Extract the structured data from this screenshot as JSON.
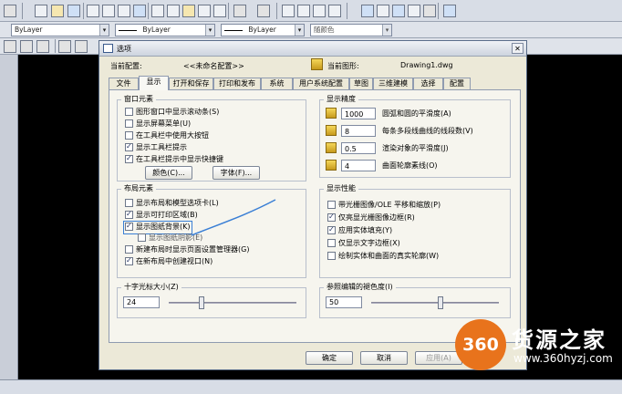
{
  "toolbar": {
    "layer_color": "ByLayer",
    "linetype": "ByLayer",
    "lineweight": "ByLayer",
    "plot_style": "随颜色"
  },
  "dialog": {
    "title": "选项",
    "current_profile_label": "当前配置:",
    "current_profile_value": "<<未命名配置>>",
    "current_drawing_label": "当前图形:",
    "current_drawing_value": "Drawing1.dwg",
    "tabs": [
      "文件",
      "显示",
      "打开和保存",
      "打印和发布",
      "系统",
      "用户系统配置",
      "草图",
      "三维建模",
      "选择",
      "配置"
    ],
    "active_tab": "显示",
    "window_elements": {
      "title": "窗口元素",
      "options": [
        {
          "label": "图形窗口中显示滚动条(S)",
          "checked": false
        },
        {
          "label": "显示屏幕菜单(U)",
          "checked": false
        },
        {
          "label": "在工具栏中使用大按钮",
          "checked": false
        },
        {
          "label": "显示工具栏提示",
          "checked": true
        },
        {
          "label": "在工具栏提示中显示快捷键",
          "checked": true
        }
      ],
      "colors_button": "颜色(C)...",
      "fonts_button": "字体(F)..."
    },
    "layout_elements": {
      "title": "布局元素",
      "options": [
        {
          "label": "显示布局和模型选项卡(L)",
          "checked": false
        },
        {
          "label": "显示可打印区域(B)",
          "checked": true
        },
        {
          "label": "显示图纸背景(K)",
          "checked": true
        },
        {
          "label": "显示图纸阴影(E)",
          "checked": false
        },
        {
          "label": "新建布局时显示页面设置管理器(G)",
          "checked": false
        },
        {
          "label": "在新布局中创建视口(N)",
          "checked": true
        }
      ]
    },
    "display_resolution": {
      "title": "显示精度",
      "items": [
        {
          "value": "1000",
          "label": "圆弧和圆的平滑度(A)"
        },
        {
          "value": "8",
          "label": "每条多段线曲线的线段数(V)"
        },
        {
          "value": "0.5",
          "label": "渲染对象的平滑度(J)"
        },
        {
          "value": "4",
          "label": "曲面轮廓素线(O)"
        }
      ]
    },
    "display_performance": {
      "title": "显示性能",
      "options": [
        {
          "label": "带光栅图像/OLE 平移和缩放(P)",
          "checked": false
        },
        {
          "label": "仅亮显光栅图像边框(R)",
          "checked": true
        },
        {
          "label": "应用实体填充(Y)",
          "checked": true
        },
        {
          "label": "仅显示文字边框(X)",
          "checked": false
        },
        {
          "label": "绘制实体和曲面的真实轮廓(W)",
          "checked": false
        }
      ]
    },
    "crosshair": {
      "title": "十字光标大小(Z)",
      "value": "24"
    },
    "reference_fade": {
      "title": "参照编辑的褪色度(I)",
      "value": "50"
    },
    "buttons": {
      "ok": "确定",
      "cancel": "取消",
      "apply": "应用(A)"
    }
  },
  "watermark": {
    "logo": "360",
    "name": "货源之家",
    "url": "www.360hyzj.com"
  },
  "colors": {
    "annotation": "#3a7fd5",
    "highlight_border": "#3a7fd5",
    "watermark_logo": "#e8731c"
  }
}
